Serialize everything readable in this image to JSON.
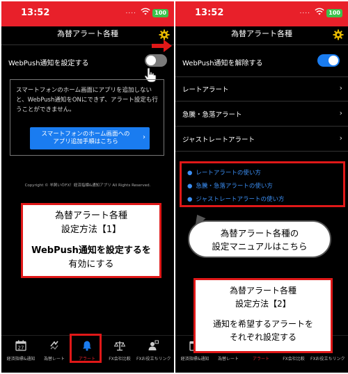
{
  "status": {
    "time": "13:52",
    "signal_dots": "....",
    "battery": "100"
  },
  "colors": {
    "accent_red": "#e8202a",
    "toggle_on": "#1a7cf0",
    "link_blue": "#3b8ff5"
  },
  "left": {
    "title": "為替アラート各種",
    "webpush_label": "WebPush通知を設定する",
    "toggle_on": false,
    "notice_text": "スマートフォンのホーム画面にアプリを追加しないと、WebPush通知をONにできず、アラート設定も行うことができません。",
    "notice_button_line1": "スマートフォンのホーム画面への",
    "notice_button_line2": "アプリ追加手順はこちら",
    "copyright": "Copyright © 羊飼いのFX！経済指標&通知アプリ All Rights Reserved.",
    "callout": {
      "line1": "為替アラート各種",
      "line2": "設定方法【1】",
      "line3": "WebPush通知を設定するを",
      "line4": "有効にする"
    },
    "tabs": [
      {
        "label": "経済指標&通知",
        "icon": "calendar-icon",
        "day": "27"
      },
      {
        "label": "為替レート",
        "icon": "exchange-icon"
      },
      {
        "label": "アラート",
        "icon": "bell-icon"
      },
      {
        "label": "FX会社比較",
        "icon": "scale-icon"
      },
      {
        "label": "FXお役立ちリンク",
        "icon": "user-link-icon"
      }
    ]
  },
  "right": {
    "title": "為替アラート各種",
    "webpush_label": "WebPush通知を解除する",
    "toggle_on": true,
    "menu": [
      {
        "label": "レートアラート"
      },
      {
        "label": "急騰・急落アラート"
      },
      {
        "label": "ジャストレートアラート"
      }
    ],
    "links": [
      {
        "label": "レートアラートの使い方"
      },
      {
        "label": "急騰・急落アラートの使い方"
      },
      {
        "label": "ジャストレートアラートの使い方"
      }
    ],
    "bubble": {
      "line1": "為替アラート各種の",
      "line2": "設定マニュアルはこちら"
    },
    "callout": {
      "line1": "為替アラート各種",
      "line2": "設定方法【2】",
      "line3": "通知を希望するアラートを",
      "line4": "それぞれ設定する"
    },
    "tabs": [
      {
        "label": "経済指標&通知"
      },
      {
        "label": "為替レート"
      },
      {
        "label": "アラート"
      },
      {
        "label": "FX会社比較"
      },
      {
        "label": "FXお役立ちリンク"
      }
    ]
  }
}
